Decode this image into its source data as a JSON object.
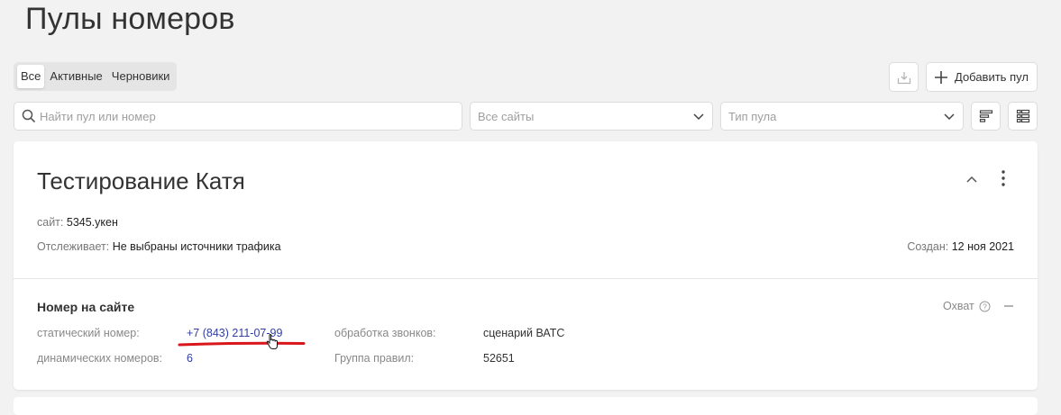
{
  "page": {
    "title": "Пулы номеров"
  },
  "filters": {
    "tabs": [
      {
        "label": "Все"
      },
      {
        "label": "Активные"
      },
      {
        "label": "Черновики"
      }
    ],
    "add_label": "Добавить пул",
    "search_placeholder": "Найти пул или номер",
    "sites_placeholder": "Все сайты",
    "type_placeholder": "Тип пула"
  },
  "pool": {
    "title": "Тестирование Катя",
    "site_label": "сайт:",
    "site_value": "5345.укен",
    "tracking_label": "Отслеживает:",
    "tracking_value": "Не выбраны источники трафика",
    "created_label": "Создан:",
    "created_value": "12 ноя 2021",
    "section": {
      "title": "Номер на сайте",
      "coverage_label": "Охват",
      "static_label": "статический номер:",
      "static_value": "+7 (843) 211-07-99",
      "dynamic_label": "динамических номеров:",
      "dynamic_value": "6",
      "processing_label": "обработка звонков:",
      "processing_value": "сценарий ВАТС",
      "rules_label": "Группа правил:",
      "rules_value": "52651"
    }
  },
  "annotation_color": "#d9161c",
  "link_color": "#2f3da3"
}
